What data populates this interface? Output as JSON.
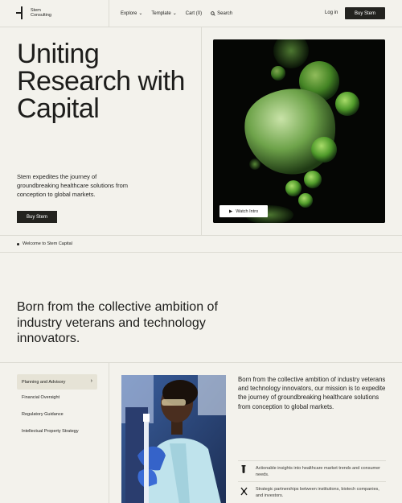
{
  "header": {
    "logo_line1": "Stem",
    "logo_line2": "Consulting",
    "nav": [
      {
        "label": "Explore",
        "caret": "⌄"
      },
      {
        "label": "Template",
        "caret": "⌄"
      },
      {
        "label": "Cart (0)",
        "caret": ""
      },
      {
        "label": "Search",
        "icon": "search-icon"
      }
    ],
    "login": "Log in",
    "buy": "Buy Stem"
  },
  "hero": {
    "title_lines": [
      "Uniting",
      "Research with",
      "Capital"
    ],
    "description": "Stem expedites the journey of groundbreaking healthcare solutions from conception to global markets.",
    "cta": "Buy Stem",
    "watch_label": "Watch Intro"
  },
  "band": {
    "text": "Welcome to Stem Capital"
  },
  "mission": {
    "title": "Born from the collective ambition of industry veterans and technology innovators."
  },
  "services": {
    "items": [
      {
        "label": "Planning and Advisory",
        "active": true
      },
      {
        "label": "Financial Oversight",
        "active": false
      },
      {
        "label": "Regulatory Guidance",
        "active": false
      },
      {
        "label": "Intellectual Property Strategy",
        "active": false
      }
    ]
  },
  "detail": {
    "body": "Born from the collective ambition of industry veterans and technology innovators, our mission is to expedite the journey of groundbreaking healthcare solutions from conception to global markets.",
    "features": [
      {
        "icon": "test-tube-icon",
        "text": "Actionable insights into healthcare market trends and consumer needs."
      },
      {
        "icon": "dna-icon",
        "text": "Strategic partnerships between institutions, biotech companies, and investors."
      }
    ]
  },
  "colors": {
    "background": "#f3f2ec",
    "ink": "#1d1d1b",
    "button": "#23231f",
    "active_tab": "#e6e3d6",
    "divider": "#dcdbd3"
  }
}
